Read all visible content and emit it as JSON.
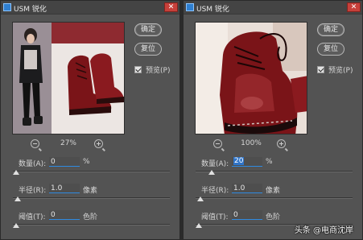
{
  "left_dialog": {
    "title": "USM 锐化",
    "close_symbol": "✕",
    "ok_label": "确定",
    "reset_label": "复位",
    "preview_label": "预览(P)",
    "preview_checked": true,
    "zoom": "27%",
    "amount_label": "数量(A):",
    "amount_value": "0",
    "amount_unit": "%",
    "amount_level": 0.02,
    "radius_label": "半径(R):",
    "radius_value": "1.0",
    "radius_unit": "像素",
    "radius_level": 0.03,
    "threshold_label": "阈值(T):",
    "threshold_value": "0",
    "threshold_unit": "色阶",
    "threshold_level": 0.02
  },
  "right_dialog": {
    "title": "USM 锐化",
    "close_symbol": "✕",
    "ok_label": "确定",
    "reset_label": "复位",
    "preview_label": "预览(P)",
    "preview_checked": true,
    "zoom": "100%",
    "amount_label": "数量(A):",
    "amount_value": "20",
    "amount_unit": "%",
    "amount_level": 0.1,
    "radius_label": "半径(R):",
    "radius_value": "1.0",
    "radius_unit": "像素",
    "radius_level": 0.03,
    "threshold_label": "阈值(T):",
    "threshold_value": "0",
    "threshold_unit": "色阶",
    "threshold_level": 0.02
  },
  "watermark": "头条 @电商沈岸",
  "colors": {
    "accent": "#2f8ae0",
    "boot": "#7a1418",
    "panel": "#535353"
  },
  "icons": [
    "photoshop-icon",
    "close-icon",
    "zoom-out-icon",
    "zoom-in-icon",
    "checkbox-checked-icon"
  ]
}
